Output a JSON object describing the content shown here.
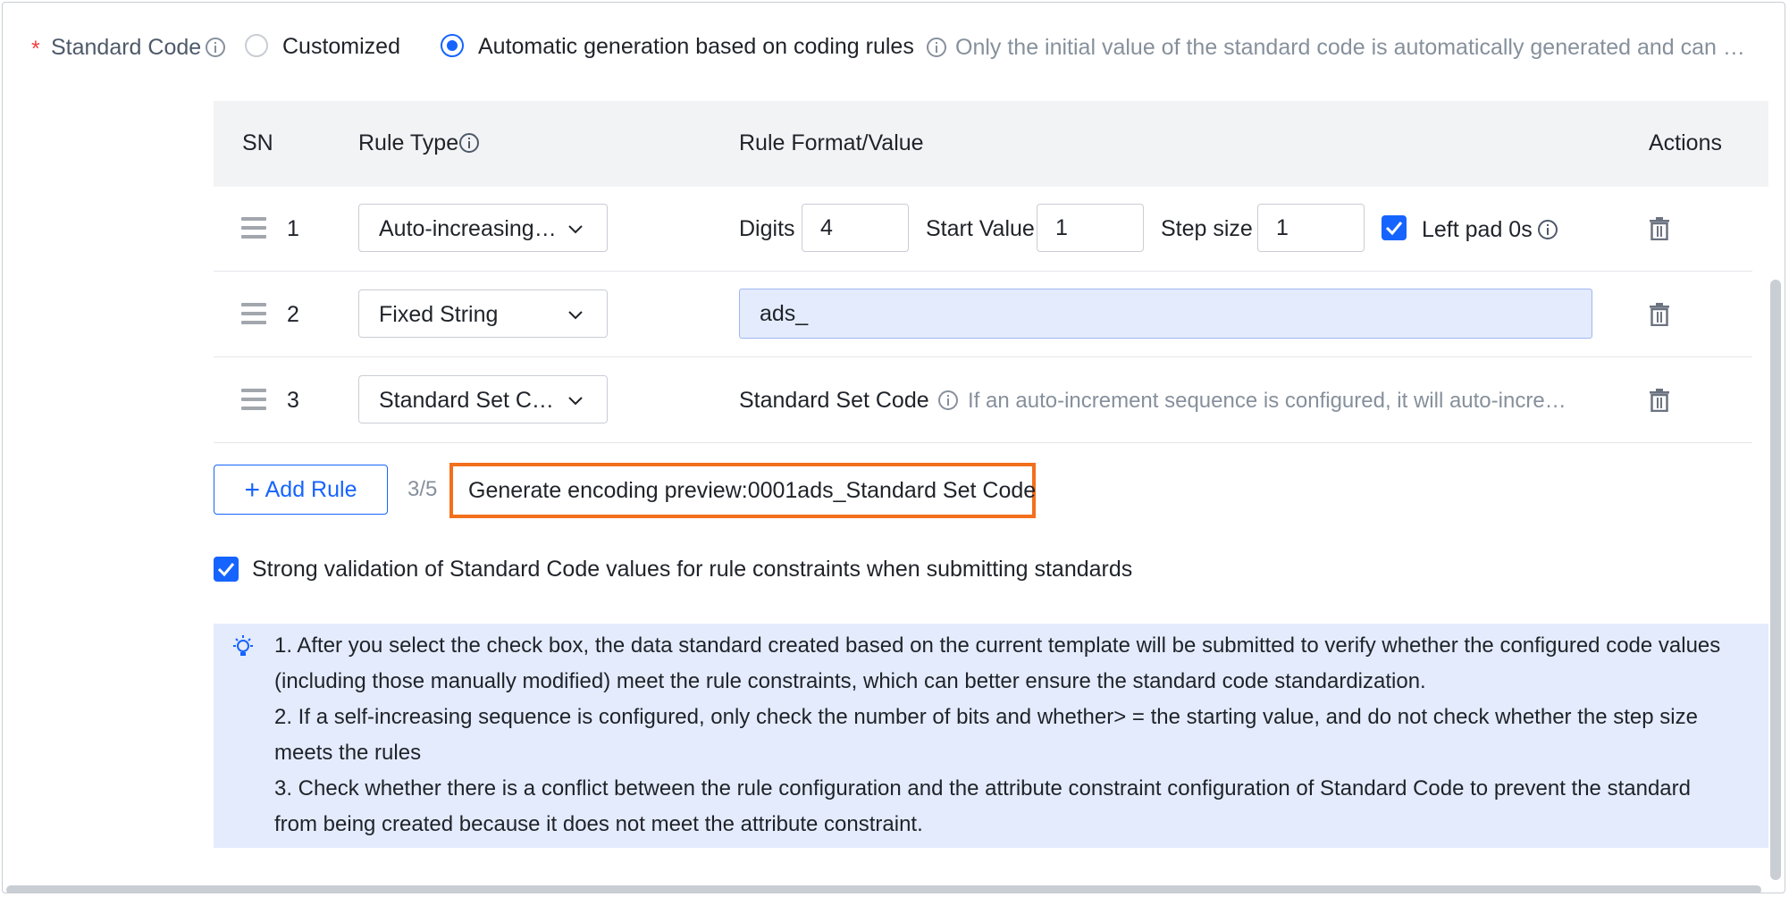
{
  "header": {
    "required_mark": "*",
    "label": "Standard Code",
    "options": [
      {
        "label": "Customized",
        "selected": false
      },
      {
        "label": "Automatic generation based on coding rules",
        "selected": true
      }
    ],
    "hint": "Only the initial value of the standard code is automatically generated and can …"
  },
  "table": {
    "columns": {
      "sn": "SN",
      "rule_type": "Rule Type",
      "rule_format": "Rule Format/Value",
      "actions": "Actions"
    },
    "rows": [
      {
        "sn": "1",
        "rule_type": "Auto-increasing …",
        "digits_label": "Digits",
        "digits_value": "4",
        "start_label": "Start Value",
        "start_value": "1",
        "step_label": "Step size",
        "step_value": "1",
        "left_pad_label": "Left pad 0s",
        "left_pad_checked": true
      },
      {
        "sn": "2",
        "rule_type": "Fixed String",
        "value": "ads_"
      },
      {
        "sn": "3",
        "rule_type": "Standard Set C…",
        "value_label": "Standard Set Code",
        "hint": "If an auto-increment sequence is configured, it will auto-incre…"
      }
    ]
  },
  "add_rule": {
    "label": "Add Rule",
    "count": "3/5"
  },
  "preview": {
    "text": "Generate encoding preview:0001ads_Standard Set Code"
  },
  "validation": {
    "checked": true,
    "label": "Strong validation of Standard Code values for rule constraints when submitting standards"
  },
  "notice": {
    "lines": [
      "1. After you select the check box, the data standard created based on the current template will be submitted to verify whether the configured code values",
      "(including those manually modified) meet the rule constraints, which can better ensure the standard code standardization.",
      "2. If a self-increasing sequence is configured, only check the number of bits and whether> = the starting value, and do not check whether the step size",
      "meets the rules",
      "3. Check whether there is a conflict between the rule configuration and the attribute constraint configuration of Standard Code to prevent the standard",
      "from being created because it does not meet the attribute constraint."
    ]
  },
  "colors": {
    "primary": "#1664ff",
    "preview_border": "#f36f1c",
    "notice_bg": "#e4ebfc",
    "required": "#f53f3f"
  }
}
